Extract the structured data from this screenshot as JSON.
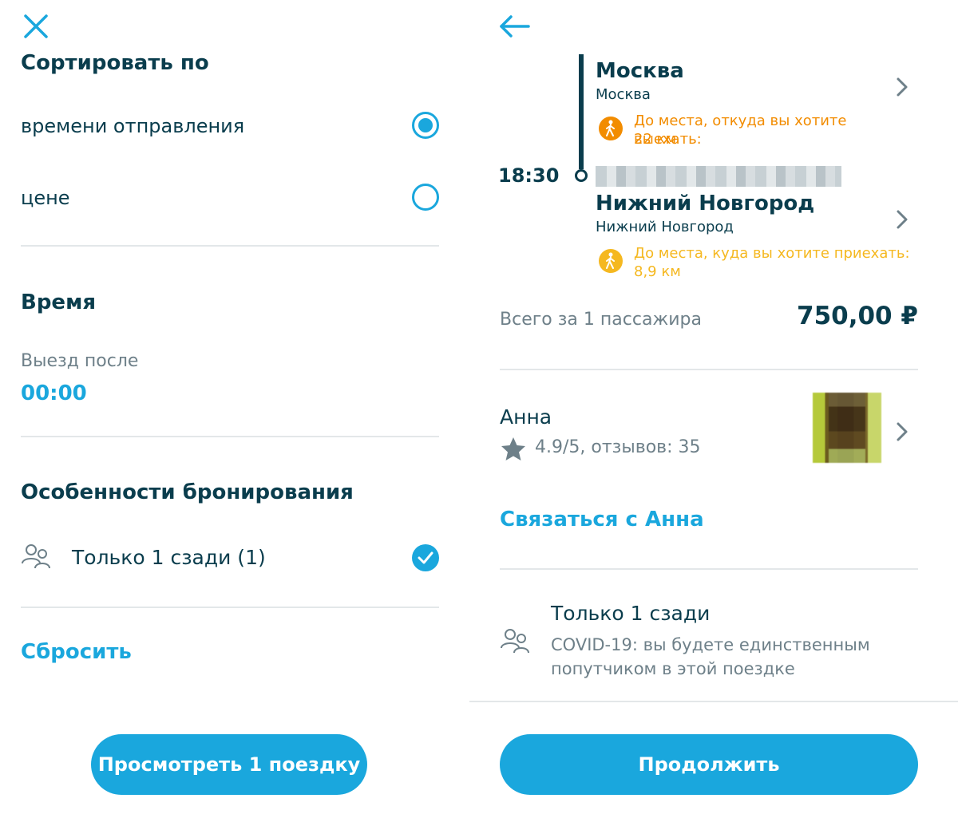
{
  "left": {
    "sort": {
      "title": "Сортировать по",
      "options": [
        {
          "label": "времени отправления",
          "selected": true
        },
        {
          "label": "цене",
          "selected": false
        }
      ]
    },
    "time": {
      "title": "Время",
      "departure_label": "Выезд после",
      "departure_value": "00:00"
    },
    "booking": {
      "title": "Особенности бронирования",
      "option_label": "Только 1 сзади (1)",
      "option_checked": true,
      "option_icon": "two-people-icon"
    },
    "reset_label": "Сбросить",
    "view_button_label": "Просмотреть 1 поездку"
  },
  "right": {
    "route": {
      "origin_city": "Москва",
      "origin_sub": "Москва",
      "origin_walk": [
        "До места, откуда вы хотите выехать:",
        "22 км"
      ],
      "arrival_time": "18:30",
      "destination_city": "Нижний Новгород",
      "destination_sub": "Нижний Новгород",
      "destination_walk": [
        "До места, куда вы хотите приехать:",
        "8,9 км"
      ]
    },
    "price": {
      "label": "Всего за 1 пассажира",
      "value": "750,00 ₽"
    },
    "driver": {
      "name": "Анна",
      "rating": "4.9/5, отзывов: 35",
      "contact_label": "Связаться с Анна"
    },
    "feature": {
      "title": "Только 1 сзади",
      "description_line1": "COVID-19: вы будете единственным",
      "description_line2": "попутчиком в этой поездке"
    },
    "continue_label": "Продолжить"
  },
  "colors": {
    "accent": "#1aa7dd",
    "text_dark": "#0a3d4d",
    "muted": "#6e8089",
    "walk_orange": "#f28c00",
    "walk_yellow": "#f5b820"
  }
}
